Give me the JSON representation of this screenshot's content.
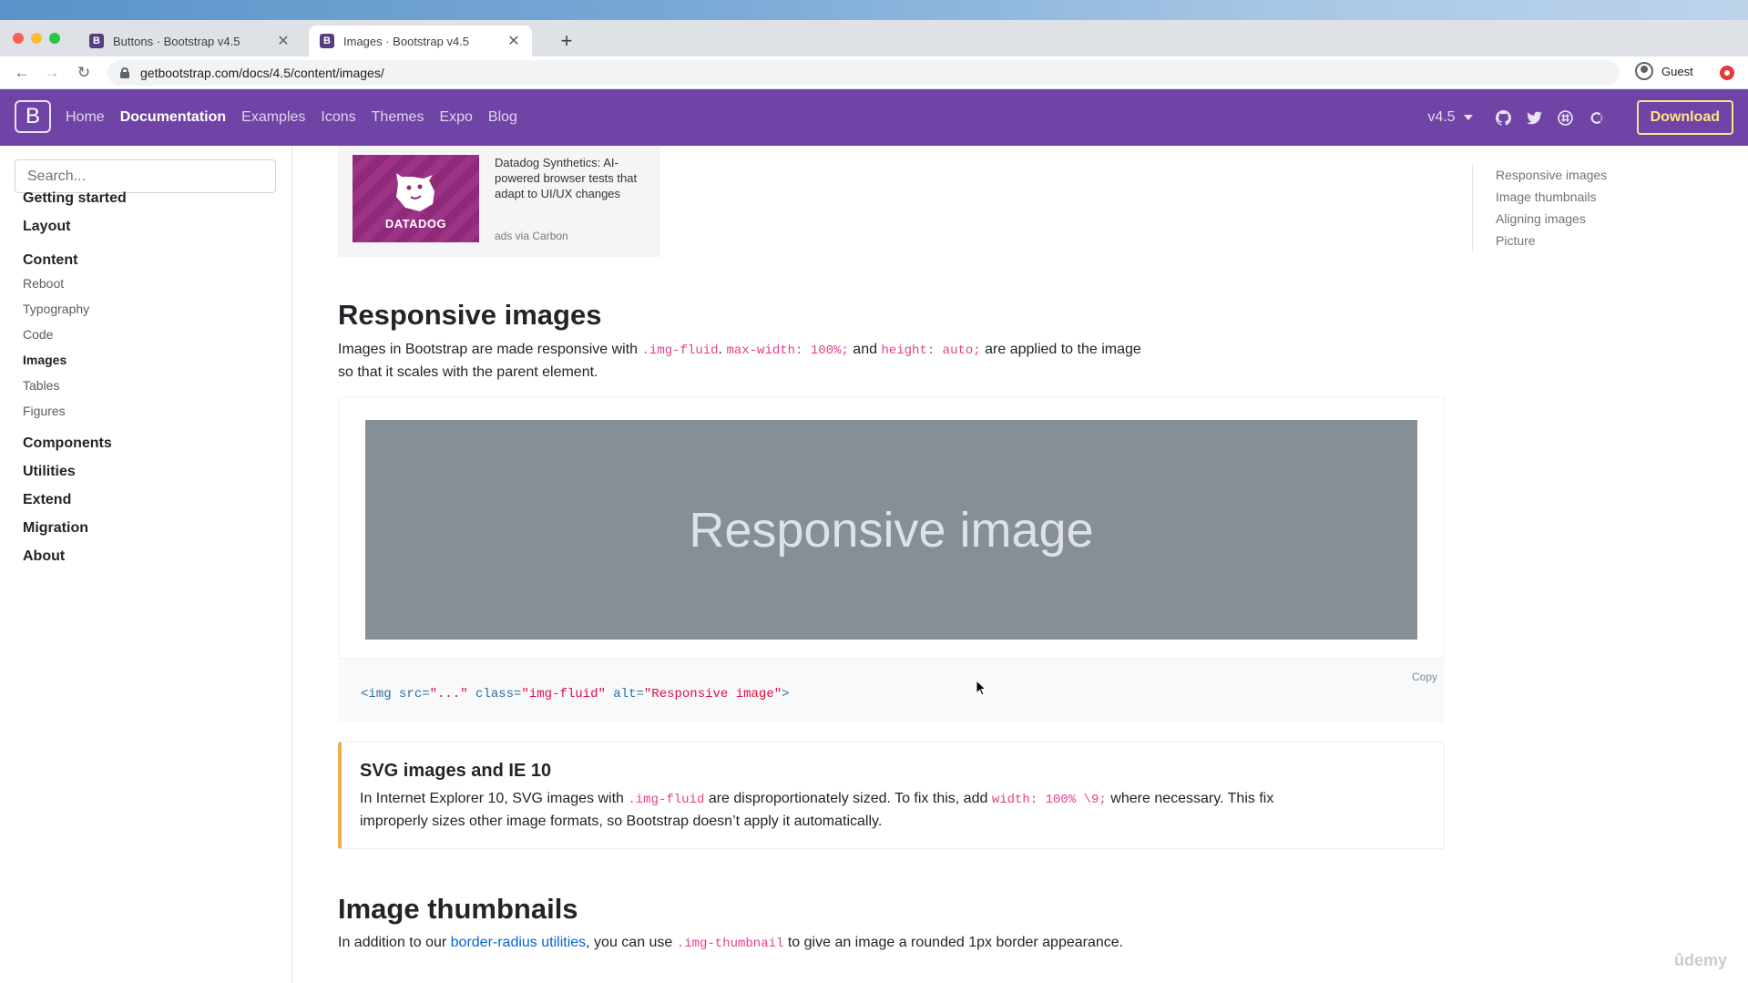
{
  "browser": {
    "tabs": [
      {
        "title": "Buttons · Bootstrap v4.5",
        "favicon": "B"
      },
      {
        "title": "Images · Bootstrap v4.5",
        "favicon": "B"
      }
    ],
    "new_tab": "+",
    "url": "getbootstrap.com/docs/4.5/content/images/",
    "profile": "Guest"
  },
  "navbar": {
    "brand": "B",
    "links": [
      "Home",
      "Documentation",
      "Examples",
      "Icons",
      "Themes",
      "Expo",
      "Blog"
    ],
    "active_link": "Documentation",
    "version": "v4.5",
    "download": "Download",
    "social_icons": [
      "github-icon",
      "twitter-icon",
      "slack-icon",
      "opencollective-icon"
    ],
    "colors": {
      "navbar_bg": "#7043a6",
      "download": "#ffe484"
    }
  },
  "sidebar": {
    "search_placeholder": "Search...",
    "groups": [
      "Getting started",
      "Layout",
      "Content",
      "Components",
      "Utilities",
      "Extend",
      "Migration",
      "About"
    ],
    "content_items": [
      "Reboot",
      "Typography",
      "Code",
      "Images",
      "Tables",
      "Figures"
    ],
    "active_item": "Images"
  },
  "ad": {
    "brand": "DATADOG",
    "text": "Datadog Synthetics: AI-powered browser tests that adapt to UI/UX changes",
    "via": "ads via Carbon"
  },
  "sections": {
    "responsive": {
      "title": "Responsive images",
      "p_1": "Images in Bootstrap are made responsive with",
      "code_1": ".img-fluid",
      "p_2": ".",
      "code_2": "max-width: 100%;",
      "p_3": " and ",
      "code_3": "height: auto;",
      "p_4": " are applied to the image",
      "p_5": "so that it scales with the parent element.",
      "placeholder_text": "Responsive image",
      "code_sample": {
        "open": "<img ",
        "attr_src": "src=",
        "val_src": "\"...\"",
        "attr_class": " class=",
        "val_class": "\"img-fluid\"",
        "attr_alt": " alt=",
        "val_alt": "\"Responsive image\"",
        "close": ">"
      },
      "copy": "Copy"
    },
    "callout": {
      "title": "SVG images and IE 10",
      "b_1": "In Internet Explorer 10, SVG images with ",
      "code_1": ".img-fluid",
      "b_2": " are disproportionately sized. To fix this, add ",
      "code_2": "width: 100% \\9;",
      "b_3": " where necessary. This fix",
      "b_4": "improperly sizes other image formats, so Bootstrap doesn’t apply it automatically."
    },
    "thumbnails": {
      "title": "Image thumbnails",
      "t_1": "In addition to our ",
      "link": "border-radius utilities",
      "t_2": ", you can use ",
      "code": ".img-thumbnail",
      "t_3": " to give an image a rounded 1px border appearance."
    }
  },
  "toc": [
    "Responsive images",
    "Image thumbnails",
    "Aligning images",
    "Picture"
  ],
  "watermark": "ûdemy"
}
